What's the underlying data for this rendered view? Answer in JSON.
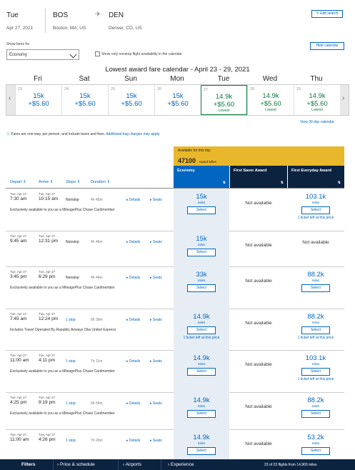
{
  "header": {
    "day": "Tue",
    "date": "Apr 27, 2021",
    "origin_code": "BOS",
    "origin_city": "Boston, MA, US",
    "dest_code": "DEN",
    "dest_city": "Denver, CO, US",
    "edit_label": "Edit search"
  },
  "filters": {
    "show_fares_label": "Show fares for",
    "fare_value": "Economy",
    "nonstop_label": "Show only nonstop flight availability in the calendar",
    "hide_calendar_label": "Hide calendar"
  },
  "calendar": {
    "title": "Lowest award fare calendar - April 23 - 29, 2021",
    "days": [
      {
        "name": "Fri",
        "num": "23",
        "miles": "15k",
        "tax": "+$5.60",
        "note": ""
      },
      {
        "name": "Sat",
        "num": "24",
        "miles": "15k",
        "tax": "+$5.60",
        "note": ""
      },
      {
        "name": "Sun",
        "num": "25",
        "miles": "15k",
        "tax": "+$5.60",
        "note": ""
      },
      {
        "name": "Mon",
        "num": "26",
        "miles": "15k",
        "tax": "+$5.60",
        "note": ""
      },
      {
        "name": "Tue",
        "num": "27",
        "miles": "14.9k",
        "tax": "+$5.60",
        "note": "Lowest"
      },
      {
        "name": "Wed",
        "num": "28",
        "miles": "14.9k",
        "tax": "+$5.60",
        "note": "Lowest"
      },
      {
        "name": "Thu",
        "num": "29",
        "miles": "14.9k",
        "tax": "+$5.60",
        "note": "Lowest"
      }
    ],
    "view_30_label": "View 30 day calendar"
  },
  "info": {
    "text": "Fares are one-way, per person, and include taxes and fees.",
    "link": "Additional bag charges may apply."
  },
  "table": {
    "available_label": "Available for this trip:",
    "available_miles": "47100",
    "available_unit": "Award Miles",
    "col_economy": "Economy",
    "col_saver": "First Saver Award",
    "col_everyday": "First Everyday Award",
    "th_depart": "Depart",
    "th_arrive": "Arrive",
    "th_stops": "Stops",
    "th_duration": "Duration",
    "details_label": "Details",
    "seats_label": "Seats",
    "select_label": "Select",
    "miles_label": "miles",
    "na_label": "Not available",
    "ticket_left": "1 ticket left at this price",
    "rows": [
      {
        "dep_day": "Tue, Apr 27",
        "dep": "7:30 am",
        "arr_day": "Tue, Apr 27",
        "arr": "10:15 am",
        "stops": "Nonstop",
        "dur": "4h 45m",
        "note": "Exclusively available to you as a MileagePlus Chase Cardmember",
        "econ": "15k",
        "saver": "Not available",
        "every": "103.1k"
      },
      {
        "dep_day": "Tue, Apr 27",
        "dep": "9:45 am",
        "arr_day": "Tue, Apr 27",
        "arr": "12:31 pm",
        "stops": "Nonstop",
        "dur": "4h 46m",
        "note": "",
        "econ": "15k",
        "saver": "Not available",
        "every": "Not available"
      },
      {
        "dep_day": "Tue, Apr 27",
        "dep": "3:45 pm",
        "arr_day": "Tue, Apr 27",
        "arr": "6:29 pm",
        "stops": "Nonstop",
        "dur": "4h 44m",
        "note": "Exclusively available to you as a MileagePlus Chase Cardmember",
        "econ": "33k",
        "saver": "Not available",
        "every": "88.2k"
      },
      {
        "dep_day": "Tue, Apr 27",
        "dep": "7:45 am",
        "arr_day": "Tue, Apr 27",
        "arr": "12:24 pm",
        "stops": "1 stop",
        "dur": "6h 39m",
        "note": "Includes Travel Operated By Republic Airways Dba United Express",
        "econ": "14.9k",
        "saver": "Not available",
        "every": "88.2k"
      },
      {
        "dep_day": "Tue, Apr 27",
        "dep": "11:00 am",
        "arr_day": "Tue, Apr 27",
        "arr": "4:11 pm",
        "stops": "1 stop",
        "dur": "7h 11m",
        "note": "Exclusively available to you as a MileagePlus Chase Cardmember",
        "econ": "14.9k",
        "saver": "Not available",
        "every": "103.1k"
      },
      {
        "dep_day": "Tue, Apr 27",
        "dep": "4:25 pm",
        "arr_day": "Tue, Apr 27",
        "arr": "9:19 pm",
        "stops": "1 stop",
        "dur": "6h 54m",
        "note": "Exclusively available to you as a MileagePlus Chase Cardmember",
        "econ": "14.9k",
        "saver": "Not available",
        "every": "88.2k"
      },
      {
        "dep_day": "Tue, Apr 27",
        "dep": "11:00 am",
        "arr_day": "Tue, Apr 27",
        "arr": "4:26 pm",
        "stops": "1 stop",
        "dur": "7h 26m",
        "note": "",
        "econ": "14.9k",
        "saver": "Not available",
        "every": "53.2k"
      }
    ]
  },
  "bottom": {
    "filters": "Filters",
    "price": "Price & schedule",
    "airports": "Airports",
    "experience": "Experience",
    "count": "23 of 23 flights from 14,900 miles"
  },
  "colors": {
    "accent": "#0066c0",
    "navy": "#0c2340",
    "gold": "#e9b72b",
    "econ_bg": "#e6edf5",
    "green": "#0a7a3c"
  }
}
